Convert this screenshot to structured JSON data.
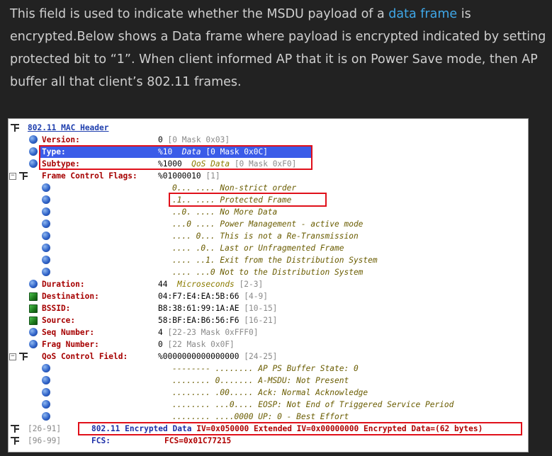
{
  "article": {
    "text_before_link": "This field is used to indicate whether the MSDU payload of a ",
    "link_text": "data frame",
    "text_after_link": " is encrypted.Below shows a Data frame where payload is encrypted indicated by setting protected bit to “1”. When client informed AP that it is on Power Save mode, then AP buffer all that client’s 802.11 frames.",
    "link_color": "#3fa7e8"
  },
  "header": {
    "title": "802.11 MAC Header"
  },
  "fields": {
    "version": {
      "label": "Version:",
      "value": "0",
      "extra": "[0 Mask 0x03]"
    },
    "type": {
      "label": "Type:",
      "value": "%10",
      "meaning": "Data",
      "extra": "[0 Mask 0x0C]"
    },
    "subtype": {
      "label": "Subtype:",
      "value": "%1000",
      "meaning": "QoS Data",
      "extra": "[0 Mask 0xF0]"
    },
    "fcf": {
      "label": "Frame Control Flags:",
      "value": "%01000010",
      "extra": "[1]"
    },
    "duration": {
      "label": "Duration:",
      "value": "44",
      "meaning": "Microseconds",
      "extra": "[2-3]"
    },
    "destination": {
      "label": "Destination:",
      "value": "04:F7:E4:EA:5B:66",
      "extra": "[4-9]"
    },
    "bssid": {
      "label": "BSSID:",
      "value": "B8:38:61:99:1A:AE",
      "extra": "[10-15]"
    },
    "source": {
      "label": "Source:",
      "value": "58:BF:EA:B6:56:F6",
      "extra": "[16-21]"
    },
    "seq": {
      "label": "Seq Number:",
      "value": "4",
      "extra": "[22-23 Mask 0xFFF0]"
    },
    "frag": {
      "label": "Frag Number:",
      "value": "0",
      "extra": "[22 Mask 0x0F]"
    },
    "qos": {
      "label": "QoS Control Field:",
      "value": "%0000000000000000",
      "extra": "[24-25]"
    }
  },
  "flags": [
    "0... .... Non-strict order",
    ".1.. .... Protected Frame",
    "..0. .... No More Data",
    "...0 .... Power Management - active mode",
    ".... 0... This is not a Re-Transmission",
    ".... .0.. Last or Unfragmented Frame",
    ".... ..1. Exit from the Distribution System",
    ".... ...0 Not to the Distribution System"
  ],
  "qos_bits": [
    "-------- ........ AP PS Buffer State: 0",
    "........ 0....... A-MSDU: Not Present",
    "........ .00..... Ack: Normal Acknowledge",
    "........ ...0.... EOSP: Not End of Triggered Service Period",
    "........ ....0000 UP: 0 - Best Effort"
  ],
  "encrypted": {
    "range": "[26-91]",
    "label": "802.11 Encrypted Data",
    "iv": "IV=0x050000",
    "ext_iv": "Extended IV=0x00000000",
    "data": "Encrypted Data=(62 bytes)"
  },
  "fcs": {
    "range": "[96-99]",
    "label": "FCS:",
    "value": "FCS=0x01C77215"
  },
  "colors": {
    "field_label": "#a60000",
    "selection": "#3b5ce8",
    "highlight_box": "#e0101a",
    "background": "#222222"
  }
}
